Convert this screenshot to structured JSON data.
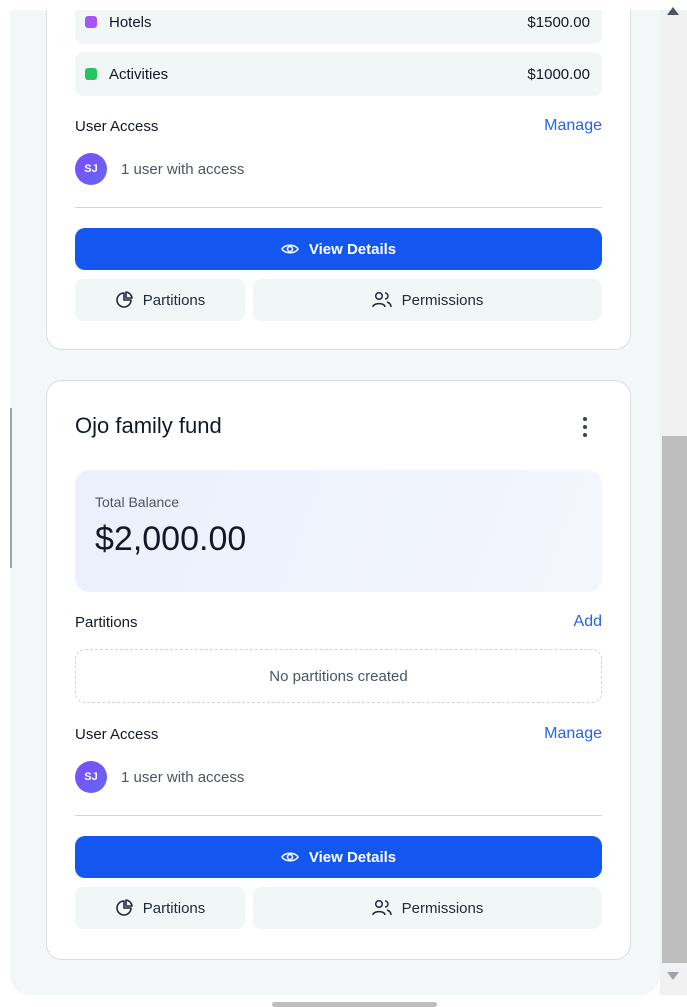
{
  "top_card": {
    "partitions": [
      {
        "name": "Hotels",
        "amount": "$1500.00",
        "color": "#a855f7"
      },
      {
        "name": "Activities",
        "amount": "$1000.00",
        "color": "#22c55e"
      }
    ],
    "user_access_label": "User Access",
    "manage_label": "Manage",
    "avatar_initials": "SJ",
    "user_count_text": "1 user with access",
    "view_details_label": "View Details",
    "partitions_button_label": "Partitions",
    "permissions_button_label": "Permissions"
  },
  "fund_card": {
    "title": "Ojo family fund",
    "balance_label": "Total Balance",
    "balance_value": "$2,000.00",
    "partitions_label": "Partitions",
    "add_label": "Add",
    "empty_partitions_text": "No partitions created",
    "user_access_label": "User Access",
    "manage_label": "Manage",
    "avatar_initials": "SJ",
    "user_count_text": "1 user with access",
    "view_details_label": "View Details",
    "partitions_button_label": "Partitions",
    "permissions_button_label": "Permissions"
  },
  "colors": {
    "primary": "#1456f0",
    "link": "#2563eb",
    "hotels": "#a855f7",
    "activities": "#22c55e"
  },
  "icons": {
    "view": "eye-icon",
    "partitions": "pie-chart-icon",
    "permissions": "users-icon",
    "menu": "kebab-menu-icon"
  }
}
